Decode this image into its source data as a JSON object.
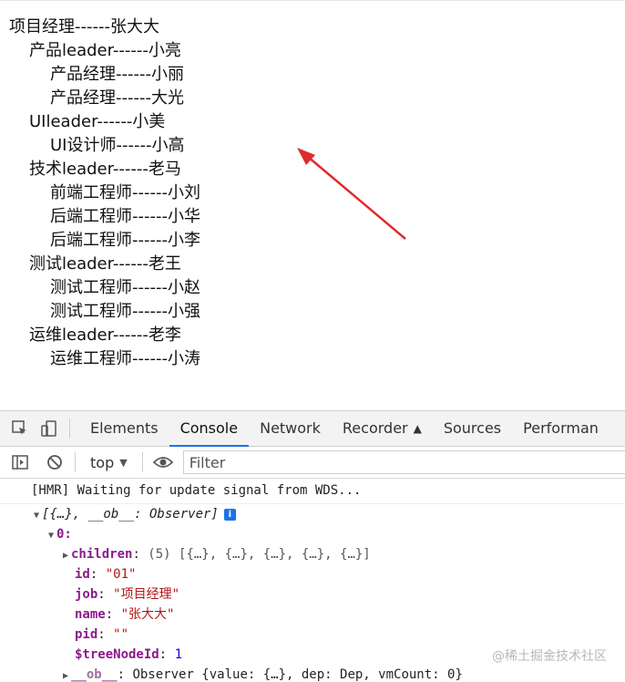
{
  "tree": {
    "items": [
      {
        "level": 1,
        "text": "项目经理------张大大"
      },
      {
        "level": 2,
        "text": "产品leader------小亮"
      },
      {
        "level": 3,
        "text": "产品经理------小丽"
      },
      {
        "level": 3,
        "text": "产品经理------大光"
      },
      {
        "level": 2,
        "text": "UIleader------小美"
      },
      {
        "level": 3,
        "text": "UI设计师------小高"
      },
      {
        "level": 2,
        "text": "技术leader------老马"
      },
      {
        "level": 3,
        "text": "前端工程师------小刘"
      },
      {
        "level": 3,
        "text": "后端工程师------小华"
      },
      {
        "level": 3,
        "text": "后端工程师------小李"
      },
      {
        "level": 2,
        "text": "测试leader------老王"
      },
      {
        "level": 3,
        "text": "测试工程师------小赵"
      },
      {
        "level": 3,
        "text": "测试工程师------小强"
      },
      {
        "level": 2,
        "text": "运维leader------老李"
      },
      {
        "level": 3,
        "text": "运维工程师------小涛"
      }
    ]
  },
  "devtools": {
    "tabs": [
      "Elements",
      "Console",
      "Network",
      "Recorder",
      "Sources",
      "Performan"
    ],
    "active_tab": "Console",
    "toolbar": {
      "context": "top",
      "filter_placeholder": "Filter"
    },
    "console": {
      "hmr_message": "[HMR] Waiting for update signal from WDS...",
      "array_summary": "[{…}, __ob__: Observer]",
      "index0": "0:",
      "children_key": "children",
      "children_val": "(5) [{…}, {…}, {…}, {…}, {…}]",
      "id_key": "id",
      "id_val": "\"01\"",
      "job_key": "job",
      "job_val": "\"项目经理\"",
      "name_key": "name",
      "name_val": "\"张大大\"",
      "pid_key": "pid",
      "pid_val": "\"\"",
      "treeid_key": "$treeNodeId",
      "treeid_val": "1",
      "ob_key": "__ob__",
      "ob_val": "Observer {value: {…}, dep: Dep, vmCount: 0}"
    }
  },
  "watermark": "@稀土掘金技术社区",
  "colors": {
    "arrow": "#e02b2b",
    "accent": "#1a73e8",
    "key": "#8b1a8b",
    "string": "#b41414"
  }
}
